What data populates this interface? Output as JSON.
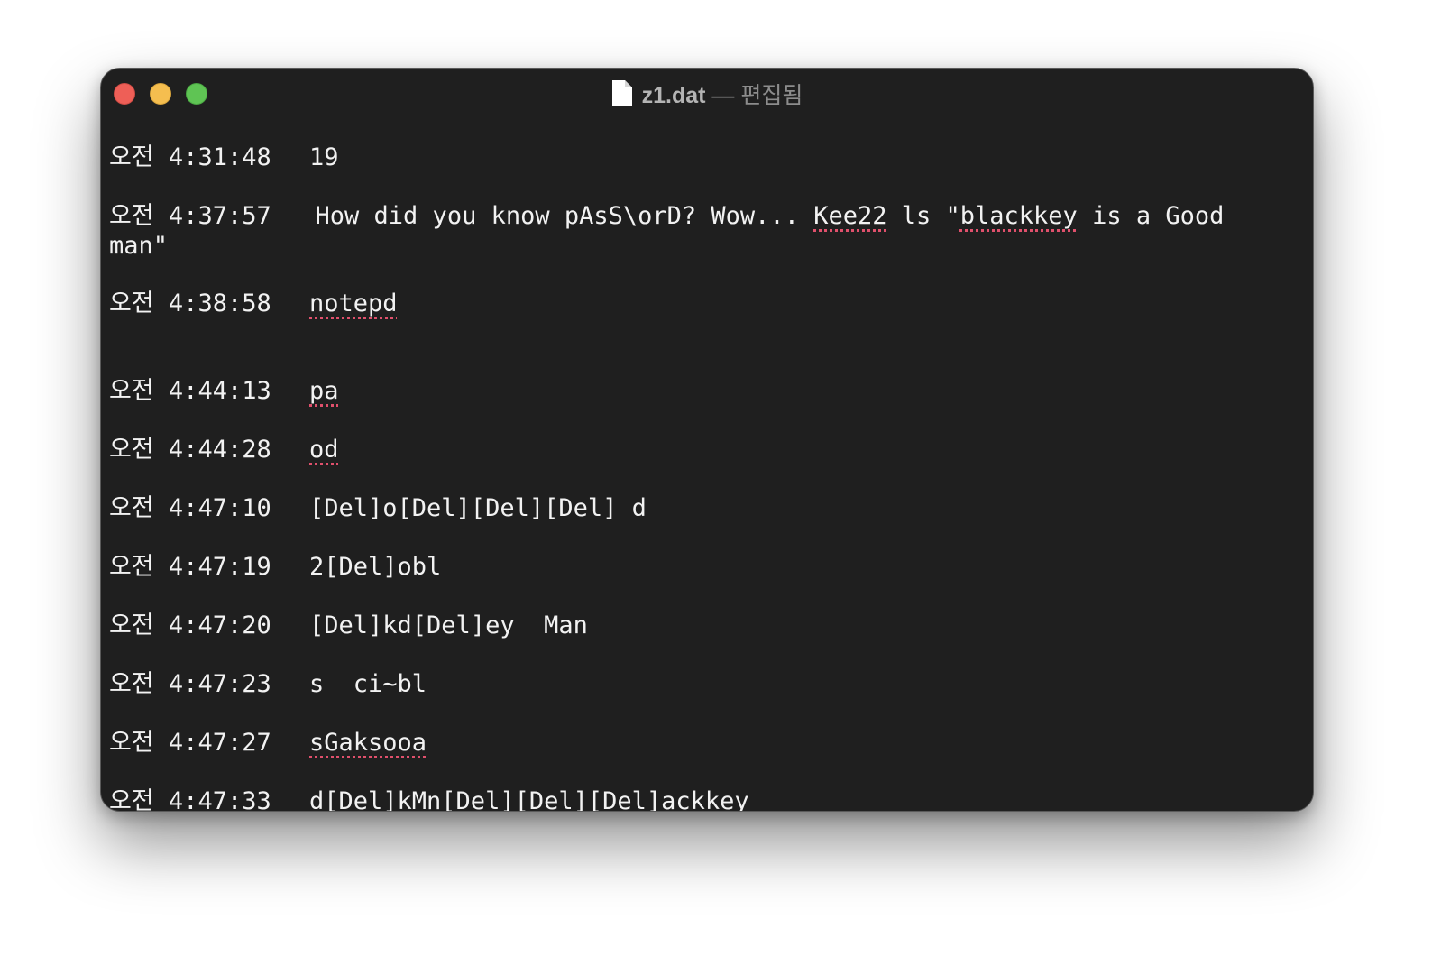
{
  "window": {
    "file_name": "z1.dat",
    "separator": "—",
    "status": "편집됨",
    "file_icon": "document-icon"
  },
  "lines": [
    {
      "ts": "오전 4:31:48",
      "segments": [
        {
          "t": "19"
        }
      ]
    },
    {
      "ts": "오전 4:37:57",
      "wrapped": true,
      "segments": [
        {
          "t": "How did you know pAsS\\orD? Wow... "
        },
        {
          "t": "Kee22",
          "sq": true
        },
        {
          "t": " ls \""
        },
        {
          "t": "blackkey",
          "sq": true
        },
        {
          "t": " is a Good\nman\""
        }
      ]
    },
    {
      "ts": "오전 4:38:58",
      "segments": [
        {
          "t": "notepd",
          "sq": true
        }
      ]
    },
    {
      "ts": "오전 4:44:13",
      "segments": [
        {
          "t": "pa",
          "sq": true
        }
      ]
    },
    {
      "ts": "오전 4:44:28",
      "segments": [
        {
          "t": "od",
          "sq": true
        }
      ]
    },
    {
      "ts": "오전 4:47:10",
      "segments": [
        {
          "t": "[Del]o[Del][Del][Del] d"
        }
      ]
    },
    {
      "ts": "오전 4:47:19",
      "segments": [
        {
          "t": "2[Del]obl"
        }
      ]
    },
    {
      "ts": "오전 4:47:20",
      "segments": [
        {
          "t": "[Del]kd[Del]ey  Man"
        }
      ]
    },
    {
      "ts": "오전 4:47:23",
      "segments": [
        {
          "t": "s  ci~bl"
        }
      ]
    },
    {
      "ts": "오전 4:47:27",
      "segments": [
        {
          "t": "sGaksooa",
          "sq": true
        }
      ]
    },
    {
      "ts": "오전 4:47:33",
      "segments": [
        {
          "t": "d[Del]kMn[Del][Del][Del]ackkey"
        }
      ]
    }
  ],
  "colors": {
    "window_bg": "#1f1f1f",
    "text": "#f2f2f2",
    "spell_underline": "#e0506c",
    "close": "#ee5f57",
    "minimize": "#f5be4f",
    "zoom": "#5fc454"
  }
}
